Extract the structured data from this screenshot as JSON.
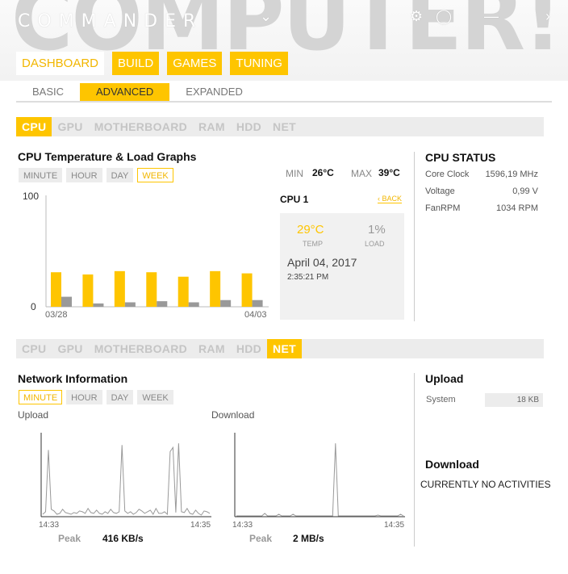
{
  "header": {
    "logo": "COMMANDER",
    "watermark": "COMPUTER!"
  },
  "main_tabs": [
    {
      "label": "DASHBOARD",
      "active": true
    },
    {
      "label": "BUILD",
      "active": false
    },
    {
      "label": "GAMES",
      "active": false
    },
    {
      "label": "TUNING",
      "active": false
    }
  ],
  "sub_tabs": [
    {
      "label": "BASIC",
      "active": false
    },
    {
      "label": "ADVANCED",
      "active": true
    },
    {
      "label": "EXPANDED",
      "active": false
    }
  ],
  "device_tabs_top": [
    {
      "label": "CPU",
      "active": true
    },
    {
      "label": "GPU",
      "active": false
    },
    {
      "label": "MOTHERBOARD",
      "active": false
    },
    {
      "label": "RAM",
      "active": false
    },
    {
      "label": "HDD",
      "active": false
    },
    {
      "label": "NET",
      "active": false
    }
  ],
  "cpu_section": {
    "title": "CPU Temperature & Load Graphs",
    "ranges": [
      {
        "label": "MINUTE",
        "active": false
      },
      {
        "label": "HOUR",
        "active": false
      },
      {
        "label": "DAY",
        "active": false
      },
      {
        "label": "WEEK",
        "active": true
      }
    ],
    "min_label": "MIN",
    "min_value": "26°C",
    "max_label": "MAX",
    "max_value": "39°C",
    "y_max_label": "100",
    "y_min_label": "0",
    "x_start": "03/28",
    "x_end": "04/03",
    "cpu_name": "CPU 1",
    "back_label": "‹ BACK",
    "temp_value": "29°C",
    "temp_label": "TEMP",
    "load_value": "1%",
    "load_label": "LOAD",
    "date": "April 04, 2017",
    "time": "2:35:21 PM"
  },
  "cpu_status": {
    "title": "CPU STATUS",
    "rows": [
      {
        "label": "Core Clock",
        "value": "1596,19 MHz"
      },
      {
        "label": "Voltage",
        "value": "0,99 V"
      },
      {
        "label": "FanRPM",
        "value": "1034 RPM"
      }
    ]
  },
  "device_tabs_bottom": [
    {
      "label": "CPU",
      "active": false
    },
    {
      "label": "GPU",
      "active": false
    },
    {
      "label": "MOTHERBOARD",
      "active": false
    },
    {
      "label": "RAM",
      "active": false
    },
    {
      "label": "HDD",
      "active": false
    },
    {
      "label": "NET",
      "active": true
    }
  ],
  "net_section": {
    "title": "Network Information",
    "ranges": [
      {
        "label": "MINUTE",
        "active": true
      },
      {
        "label": "HOUR",
        "active": false
      },
      {
        "label": "DAY",
        "active": false
      },
      {
        "label": "WEEK",
        "active": false
      }
    ],
    "upload_label": "Upload",
    "download_label": "Download",
    "upload_x_start": "14:33",
    "upload_x_end": "14:35",
    "download_x_start": "14:33",
    "download_x_end": "14:35",
    "peak_label": "Peak",
    "upload_peak": "416 KB/s",
    "download_peak": "2 MB/s"
  },
  "upload_panel": {
    "title": "Upload",
    "system_label": "System",
    "system_value": "18 KB"
  },
  "download_panel": {
    "title": "Download",
    "status": "CURRENTLY NO ACTIVITIES"
  },
  "colors": {
    "accent": "#fec500",
    "load": "#999999",
    "line": "#999999"
  },
  "chart_data": [
    {
      "type": "bar",
      "title": "CPU Temperature & Load Graphs",
      "ylim": [
        0,
        100
      ],
      "x_start_label": "03/28",
      "x_end_label": "04/03",
      "series": [
        {
          "name": "TEMP",
          "values": [
            31,
            29,
            32,
            31,
            27,
            32,
            30
          ]
        },
        {
          "name": "LOAD",
          "values": [
            9,
            3,
            4,
            5,
            4,
            6,
            6
          ]
        }
      ]
    },
    {
      "type": "line",
      "title": "Upload",
      "x_start_label": "14:33",
      "x_end_label": "14:35",
      "values": [
        2,
        5,
        80,
        8,
        6,
        2,
        3,
        8,
        4,
        3,
        2,
        4,
        3,
        6,
        5,
        3,
        9,
        4,
        3,
        7,
        3,
        2,
        5,
        3,
        8,
        4,
        3,
        5,
        86,
        6,
        3,
        5,
        2,
        4,
        8,
        6,
        3,
        5,
        7,
        2,
        9,
        3,
        3,
        5,
        2,
        78,
        83,
        4,
        88,
        5,
        4,
        9,
        3,
        2,
        7,
        3,
        1,
        6,
        5,
        3
      ]
    },
    {
      "type": "line",
      "title": "Download",
      "x_start_label": "14:33",
      "x_end_label": "14:35",
      "values": [
        0,
        0,
        0,
        0,
        0,
        0,
        0,
        0,
        0,
        0,
        3,
        0,
        0,
        0,
        0,
        2,
        0,
        0,
        0,
        0,
        2,
        0,
        0,
        0,
        0,
        0,
        0,
        0,
        0,
        0,
        0,
        0,
        0,
        0,
        0,
        88,
        0,
        0,
        0,
        0,
        0,
        0,
        0,
        0,
        0,
        0,
        0,
        0,
        0,
        0,
        1,
        0,
        0,
        0,
        0,
        0,
        0,
        0,
        2,
        0
      ]
    }
  ]
}
